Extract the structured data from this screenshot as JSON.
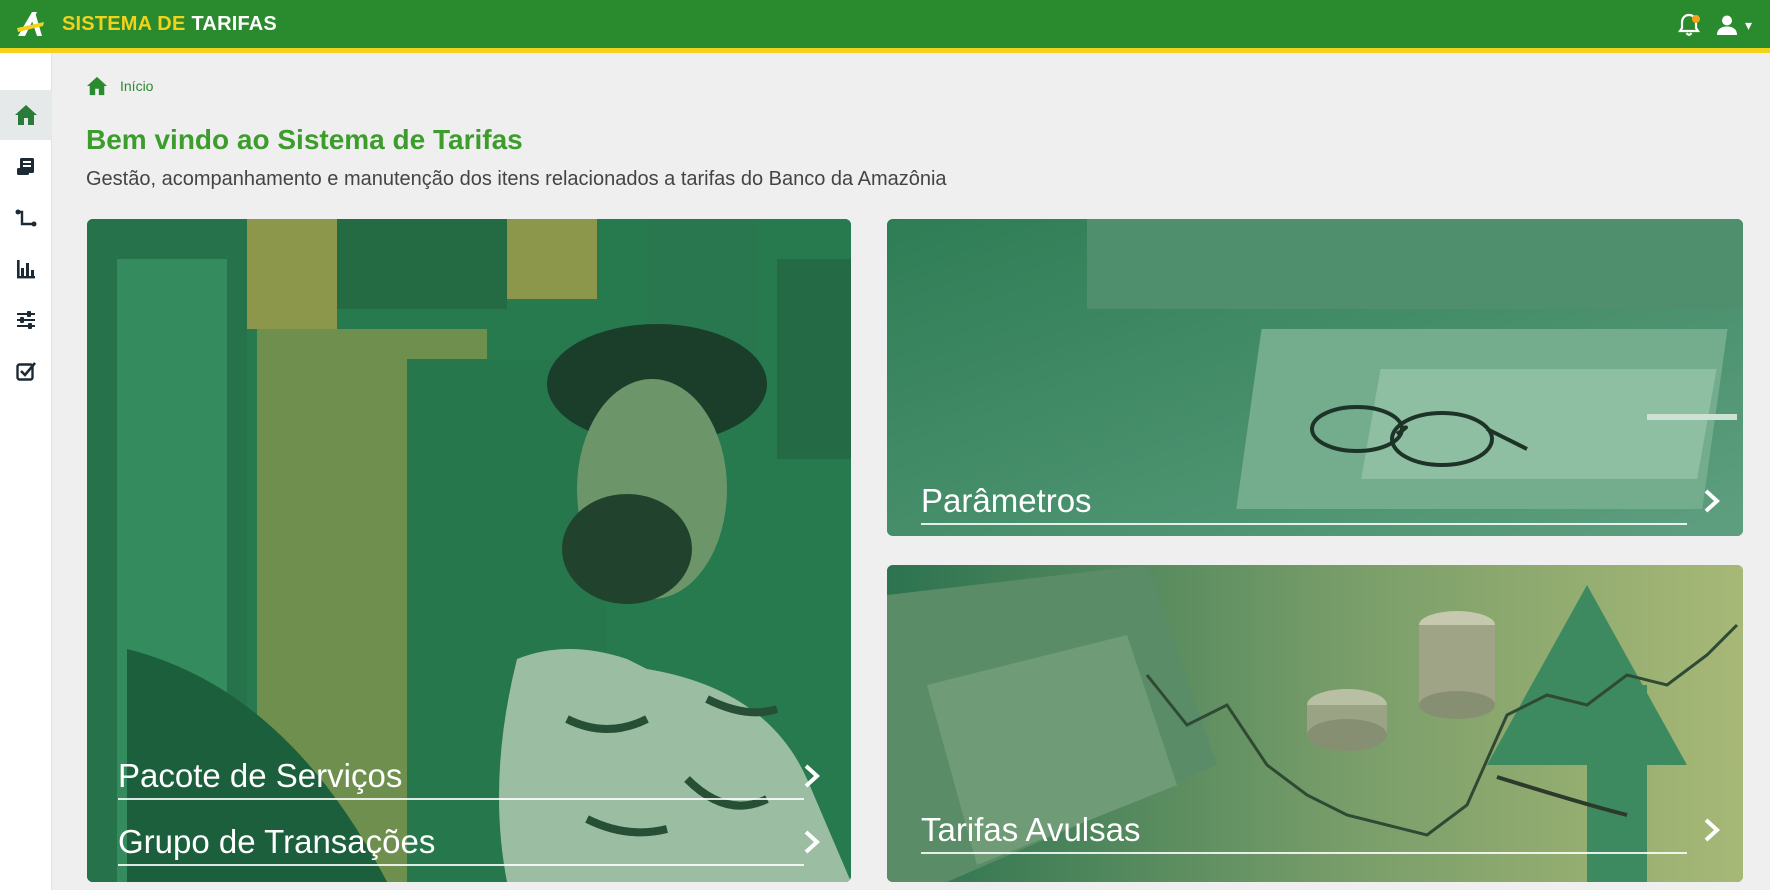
{
  "header": {
    "brand_part1": "SISTEMA DE",
    "brand_part2": "TARIFAS",
    "bell_icon": "bell-icon",
    "user_icon": "user-icon",
    "caret": "▾"
  },
  "sidebar": {
    "items": [
      {
        "icon": "home-icon",
        "active": true
      },
      {
        "icon": "receipt-icon",
        "active": false
      },
      {
        "icon": "route-icon",
        "active": false
      },
      {
        "icon": "bar-chart-icon",
        "active": false
      },
      {
        "icon": "sliders-icon",
        "active": false
      },
      {
        "icon": "checkbox-icon",
        "active": false
      }
    ]
  },
  "breadcrumb": {
    "home_label": "Início"
  },
  "main": {
    "title": "Bem vindo ao Sistema de Tarifas",
    "subtitle": "Gestão, acompanhamento e manutenção dos itens relacionados a tarifas do Banco da Amazônia"
  },
  "cards": {
    "pacote": "Pacote de Serviços",
    "grupo": "Grupo de Transações",
    "parametros": "Parâmetros",
    "tarifas_avulsas": "Tarifas Avulsas"
  },
  "colors": {
    "brand_green": "#2a8a2e",
    "brand_yellow": "#f2d21b",
    "title_green": "#3c9c2c",
    "card_green": "#2c7a4f"
  }
}
